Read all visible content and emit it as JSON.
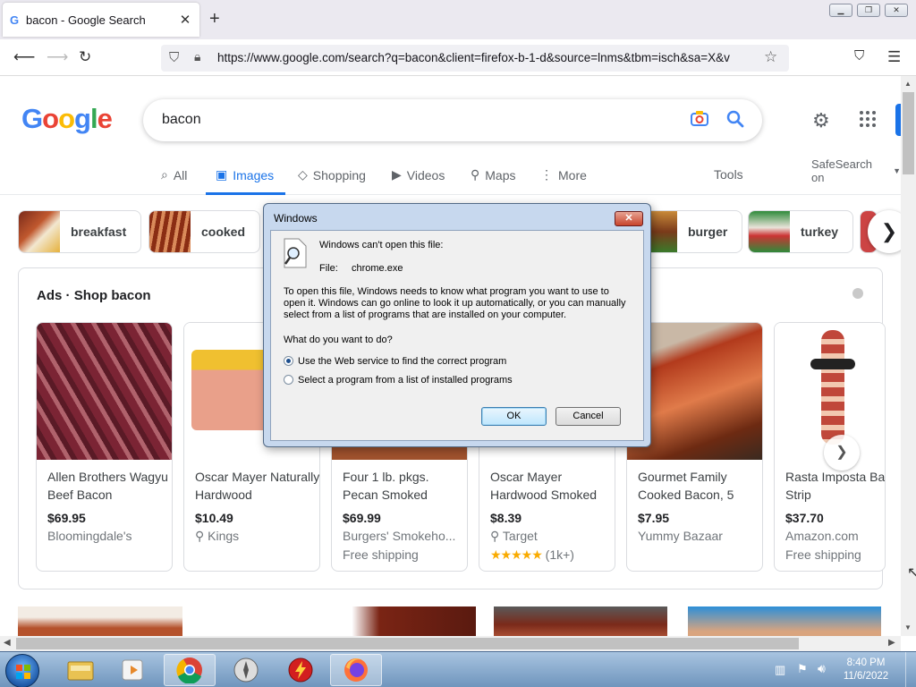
{
  "browser": {
    "tab_title": "bacon - Google Search",
    "tab_favicon": "G",
    "url": "https://www.google.com/search?q=bacon&client=firefox-b-1-d&source=lnms&tbm=isch&sa=X&v"
  },
  "google": {
    "logo": [
      "G",
      "o",
      "o",
      "g",
      "l",
      "e"
    ],
    "logo_colors": [
      "#4285f4",
      "#ea4335",
      "#fbbc05",
      "#4285f4",
      "#34a853",
      "#ea4335"
    ],
    "query": "bacon",
    "tabs": [
      {
        "icon": "search-icon",
        "glyph": "⌕",
        "label": "All"
      },
      {
        "icon": "image-icon",
        "glyph": "▣",
        "label": "Images"
      },
      {
        "icon": "tag-icon",
        "glyph": "◇",
        "label": "Shopping"
      },
      {
        "icon": "play-icon",
        "glyph": "▶",
        "label": "Videos"
      },
      {
        "icon": "map-pin-icon",
        "glyph": "⚲",
        "label": "Maps"
      },
      {
        "icon": "more-icon",
        "glyph": "⋮",
        "label": "More"
      }
    ],
    "tools": "Tools",
    "safesearch": "SafeSearch on",
    "chips": [
      "breakfast",
      "cooked",
      "burger",
      "turkey"
    ],
    "ads_prefix": "Ads",
    "ads_title": "Shop bacon",
    "products": [
      {
        "title": "Allen Brothers Wagyu Beef Bacon",
        "price": "$69.95",
        "store": "Bloomingdale's",
        "extra": ""
      },
      {
        "title": "Oscar Mayer Naturally Hardwood",
        "price": "$10.49",
        "store": "Kings",
        "extra": ""
      },
      {
        "title": "Four 1 lb. pkgs. Pecan Smoked",
        "price": "$69.99",
        "store": "Burgers' Smokeho...",
        "extra": "Free shipping"
      },
      {
        "title": "Oscar Mayer Hardwood Smoked",
        "price": "$8.39",
        "store": "Target",
        "extra": "(1k+)"
      },
      {
        "title": "Gourmet Family Cooked Bacon, 5",
        "price": "$7.95",
        "store": "Yummy Bazaar",
        "extra": ""
      },
      {
        "title": "Rasta Imposta Bacon Strip",
        "price": "$37.70",
        "store": "Amazon.com",
        "extra": "Free shipping"
      }
    ],
    "rating_stars": 4.5
  },
  "dialog": {
    "title": "Windows",
    "close": "✕",
    "heading": "Windows can't open this file:",
    "file_label": "File:",
    "file_name": "chrome.exe",
    "description": "To open this file, Windows needs to know what program you want to use to open it. Windows can go online to look it up automatically, or you can manually select from a list of programs that are installed on your computer.",
    "question": "What do you want to do?",
    "option1": "Use the Web service to find the correct program",
    "option2": "Select a program from a list of installed programs",
    "ok": "OK",
    "cancel": "Cancel"
  },
  "taskbar": {
    "time": "8:40 PM",
    "date": "11/6/2022"
  }
}
